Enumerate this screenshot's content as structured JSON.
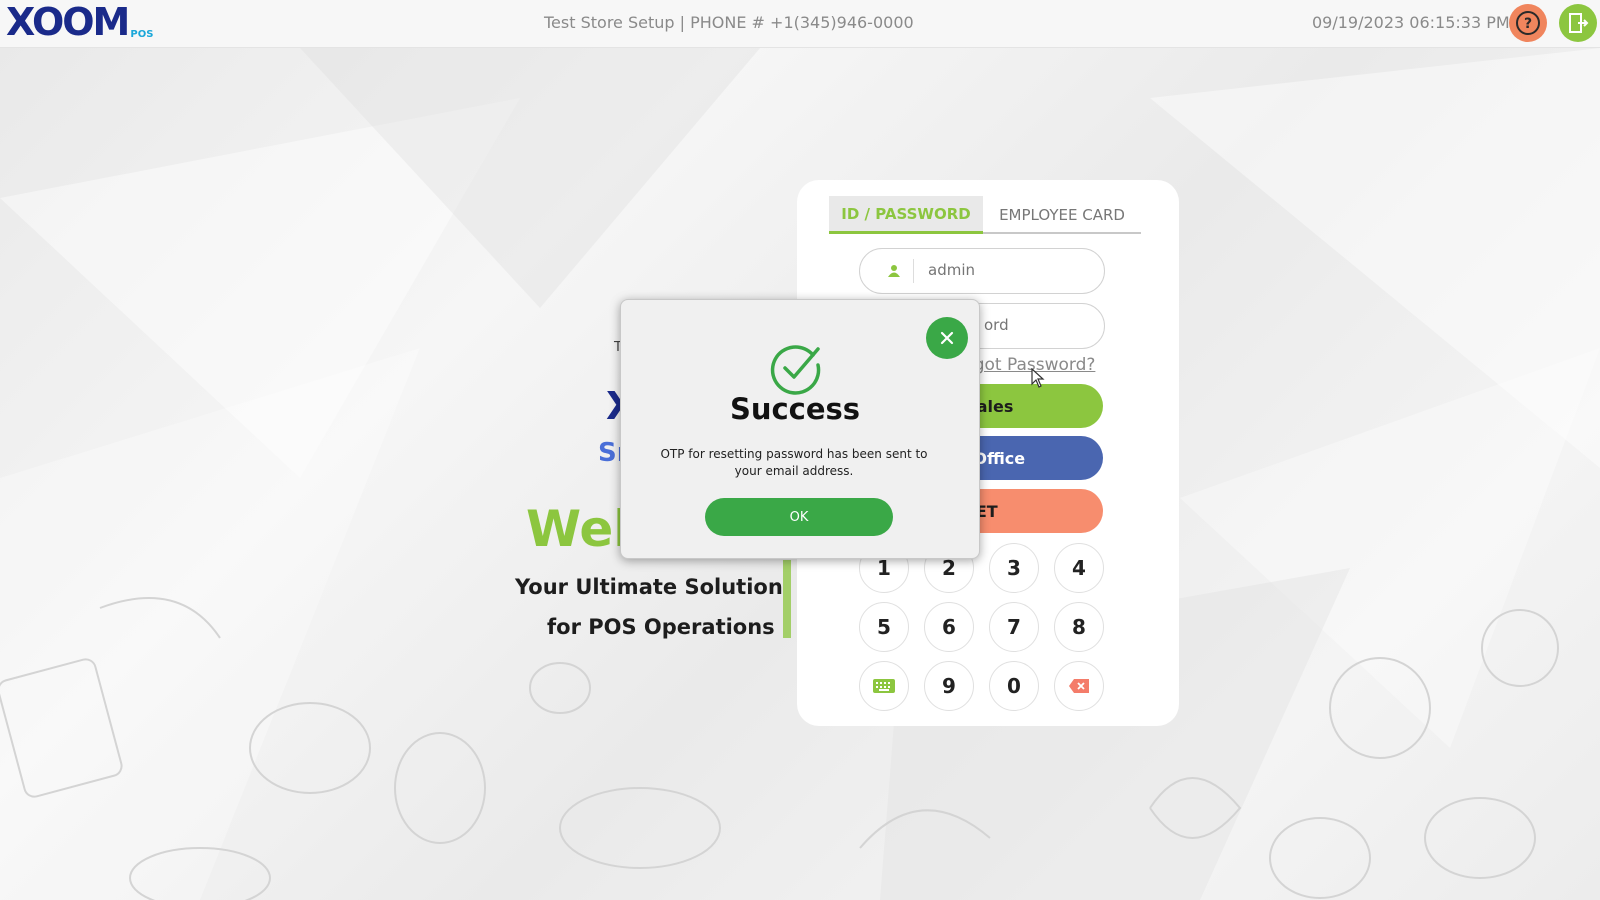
{
  "header": {
    "logo_main": "XOOM",
    "logo_sub": "POS",
    "store_info": "Test Store Setup | PHONE # +1(345)946-0000",
    "datetime": "09/19/2023 06:15:33 PM",
    "help_icon": "question-circle-icon",
    "logout_icon": "logout-door-icon",
    "help_color": "#f0855d",
    "logout_color": "#8cc63f"
  },
  "welcome": {
    "small_text": "T",
    "logo_text": "X",
    "sub_text": "Sı",
    "title": "Wel",
    "tagline_line1": "Your Ultimate Solution",
    "tagline_line2": "for POS Operations"
  },
  "login": {
    "tabs": [
      {
        "label": "ID / PASSWORD",
        "active": true
      },
      {
        "label": "EMPLOYEE CARD",
        "active": false
      }
    ],
    "username_placeholder": "admin",
    "password_placeholder": "ord",
    "user_icon": "user-icon",
    "forgot_password": "rgot Password?",
    "btn_sales": "o Sales",
    "btn_back_office": "ack Office",
    "btn_reset": "SET",
    "keypad": [
      {
        "label": "1"
      },
      {
        "label": "2"
      },
      {
        "label": "3"
      },
      {
        "label": "4"
      },
      {
        "label": "5"
      },
      {
        "label": "6"
      },
      {
        "label": "7"
      },
      {
        "label": "8"
      },
      {
        "label": "",
        "icon": "keyboard-icon"
      },
      {
        "label": "9"
      },
      {
        "label": "0"
      },
      {
        "label": "",
        "icon": "backspace-icon"
      }
    ],
    "accent_color": "#8cc63f",
    "back_office_color": "#4a66b0",
    "reset_color": "#f78d6e"
  },
  "modal": {
    "title": "Success",
    "message": "OTP for resetting password has been sent to your email address.",
    "ok_label": "OK",
    "check_icon": "check-circle-icon",
    "close_icon": "close-icon",
    "accent_color": "#3aa847"
  }
}
